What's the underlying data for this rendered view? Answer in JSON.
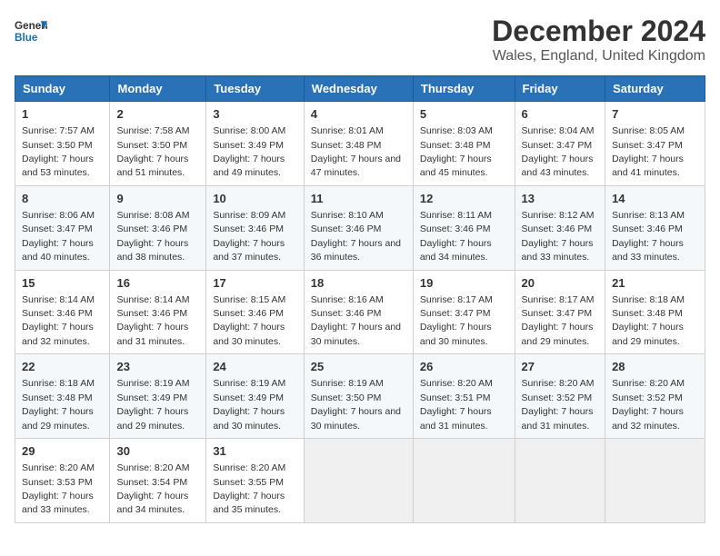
{
  "header": {
    "logo_general": "General",
    "logo_blue": "Blue",
    "title": "December 2024",
    "subtitle": "Wales, England, United Kingdom"
  },
  "days_of_week": [
    "Sunday",
    "Monday",
    "Tuesday",
    "Wednesday",
    "Thursday",
    "Friday",
    "Saturday"
  ],
  "weeks": [
    [
      {
        "day": "1",
        "sunrise": "7:57 AM",
        "sunset": "3:50 PM",
        "daylight": "7 hours and 53 minutes."
      },
      {
        "day": "2",
        "sunrise": "7:58 AM",
        "sunset": "3:50 PM",
        "daylight": "7 hours and 51 minutes."
      },
      {
        "day": "3",
        "sunrise": "8:00 AM",
        "sunset": "3:49 PM",
        "daylight": "7 hours and 49 minutes."
      },
      {
        "day": "4",
        "sunrise": "8:01 AM",
        "sunset": "3:48 PM",
        "daylight": "7 hours and 47 minutes."
      },
      {
        "day": "5",
        "sunrise": "8:03 AM",
        "sunset": "3:48 PM",
        "daylight": "7 hours and 45 minutes."
      },
      {
        "day": "6",
        "sunrise": "8:04 AM",
        "sunset": "3:47 PM",
        "daylight": "7 hours and 43 minutes."
      },
      {
        "day": "7",
        "sunrise": "8:05 AM",
        "sunset": "3:47 PM",
        "daylight": "7 hours and 41 minutes."
      }
    ],
    [
      {
        "day": "8",
        "sunrise": "8:06 AM",
        "sunset": "3:47 PM",
        "daylight": "7 hours and 40 minutes."
      },
      {
        "day": "9",
        "sunrise": "8:08 AM",
        "sunset": "3:46 PM",
        "daylight": "7 hours and 38 minutes."
      },
      {
        "day": "10",
        "sunrise": "8:09 AM",
        "sunset": "3:46 PM",
        "daylight": "7 hours and 37 minutes."
      },
      {
        "day": "11",
        "sunrise": "8:10 AM",
        "sunset": "3:46 PM",
        "daylight": "7 hours and 36 minutes."
      },
      {
        "day": "12",
        "sunrise": "8:11 AM",
        "sunset": "3:46 PM",
        "daylight": "7 hours and 34 minutes."
      },
      {
        "day": "13",
        "sunrise": "8:12 AM",
        "sunset": "3:46 PM",
        "daylight": "7 hours and 33 minutes."
      },
      {
        "day": "14",
        "sunrise": "8:13 AM",
        "sunset": "3:46 PM",
        "daylight": "7 hours and 33 minutes."
      }
    ],
    [
      {
        "day": "15",
        "sunrise": "8:14 AM",
        "sunset": "3:46 PM",
        "daylight": "7 hours and 32 minutes."
      },
      {
        "day": "16",
        "sunrise": "8:14 AM",
        "sunset": "3:46 PM",
        "daylight": "7 hours and 31 minutes."
      },
      {
        "day": "17",
        "sunrise": "8:15 AM",
        "sunset": "3:46 PM",
        "daylight": "7 hours and 30 minutes."
      },
      {
        "day": "18",
        "sunrise": "8:16 AM",
        "sunset": "3:46 PM",
        "daylight": "7 hours and 30 minutes."
      },
      {
        "day": "19",
        "sunrise": "8:17 AM",
        "sunset": "3:47 PM",
        "daylight": "7 hours and 30 minutes."
      },
      {
        "day": "20",
        "sunrise": "8:17 AM",
        "sunset": "3:47 PM",
        "daylight": "7 hours and 29 minutes."
      },
      {
        "day": "21",
        "sunrise": "8:18 AM",
        "sunset": "3:48 PM",
        "daylight": "7 hours and 29 minutes."
      }
    ],
    [
      {
        "day": "22",
        "sunrise": "8:18 AM",
        "sunset": "3:48 PM",
        "daylight": "7 hours and 29 minutes."
      },
      {
        "day": "23",
        "sunrise": "8:19 AM",
        "sunset": "3:49 PM",
        "daylight": "7 hours and 29 minutes."
      },
      {
        "day": "24",
        "sunrise": "8:19 AM",
        "sunset": "3:49 PM",
        "daylight": "7 hours and 30 minutes."
      },
      {
        "day": "25",
        "sunrise": "8:19 AM",
        "sunset": "3:50 PM",
        "daylight": "7 hours and 30 minutes."
      },
      {
        "day": "26",
        "sunrise": "8:20 AM",
        "sunset": "3:51 PM",
        "daylight": "7 hours and 31 minutes."
      },
      {
        "day": "27",
        "sunrise": "8:20 AM",
        "sunset": "3:52 PM",
        "daylight": "7 hours and 31 minutes."
      },
      {
        "day": "28",
        "sunrise": "8:20 AM",
        "sunset": "3:52 PM",
        "daylight": "7 hours and 32 minutes."
      }
    ],
    [
      {
        "day": "29",
        "sunrise": "8:20 AM",
        "sunset": "3:53 PM",
        "daylight": "7 hours and 33 minutes."
      },
      {
        "day": "30",
        "sunrise": "8:20 AM",
        "sunset": "3:54 PM",
        "daylight": "7 hours and 34 minutes."
      },
      {
        "day": "31",
        "sunrise": "8:20 AM",
        "sunset": "3:55 PM",
        "daylight": "7 hours and 35 minutes."
      },
      null,
      null,
      null,
      null
    ]
  ],
  "labels": {
    "sunrise": "Sunrise:",
    "sunset": "Sunset:",
    "daylight": "Daylight:"
  }
}
